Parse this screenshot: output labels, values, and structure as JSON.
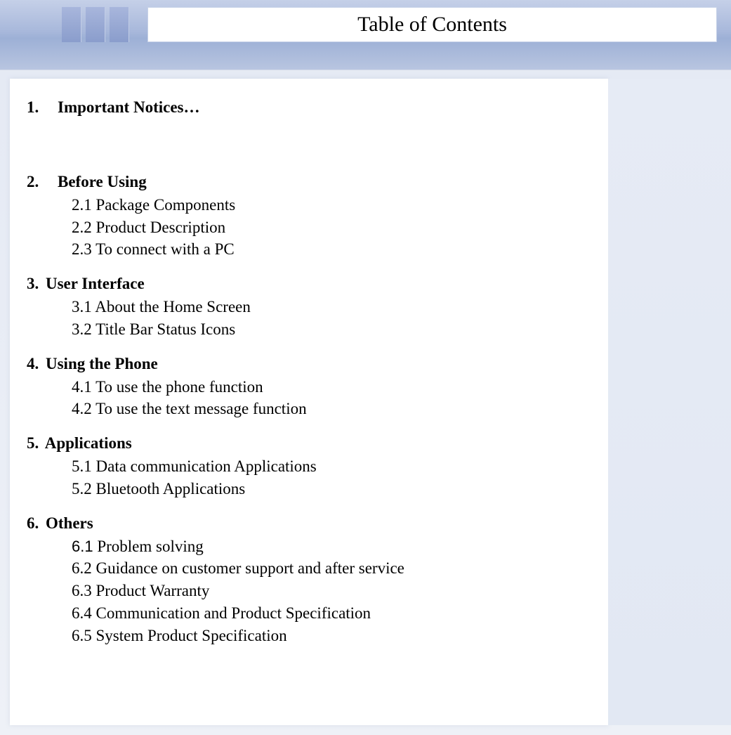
{
  "header": {
    "title": "Table of Contents"
  },
  "sections": {
    "s1": {
      "num": "1.",
      "title": "Important Notices…"
    },
    "s2": {
      "num": "2.",
      "title": "Before Using",
      "i1": "2.1 Package Components",
      "i2": "2.2 Product Description",
      "i3": "2.3 To connect with a PC"
    },
    "s3": {
      "num": "3.",
      "title": "User Interface",
      "i1": "3.1 About the Home Screen",
      "i2": "3.2 Title Bar Status Icons"
    },
    "s4": {
      "num": "4.",
      "title": "Using the Phone",
      "i1": "4.1 To use the phone function",
      "i2": "4.2 To use the text message function"
    },
    "s5": {
      "num": "5.",
      "title": "Applications",
      "i1": "5.1 Data communication Applications",
      "i2": "5.2 Bluetooth Applications"
    },
    "s6": {
      "num": "6.",
      "title": "Others",
      "i1n": "6.1",
      "i1t": " Problem solving",
      "i2": "6.2 Guidance on customer support and after service",
      "i3": "6.3 Product Warranty",
      "i4": "6.4 Communication and Product Specification",
      "i5": "6.5 System Product Specification"
    }
  }
}
